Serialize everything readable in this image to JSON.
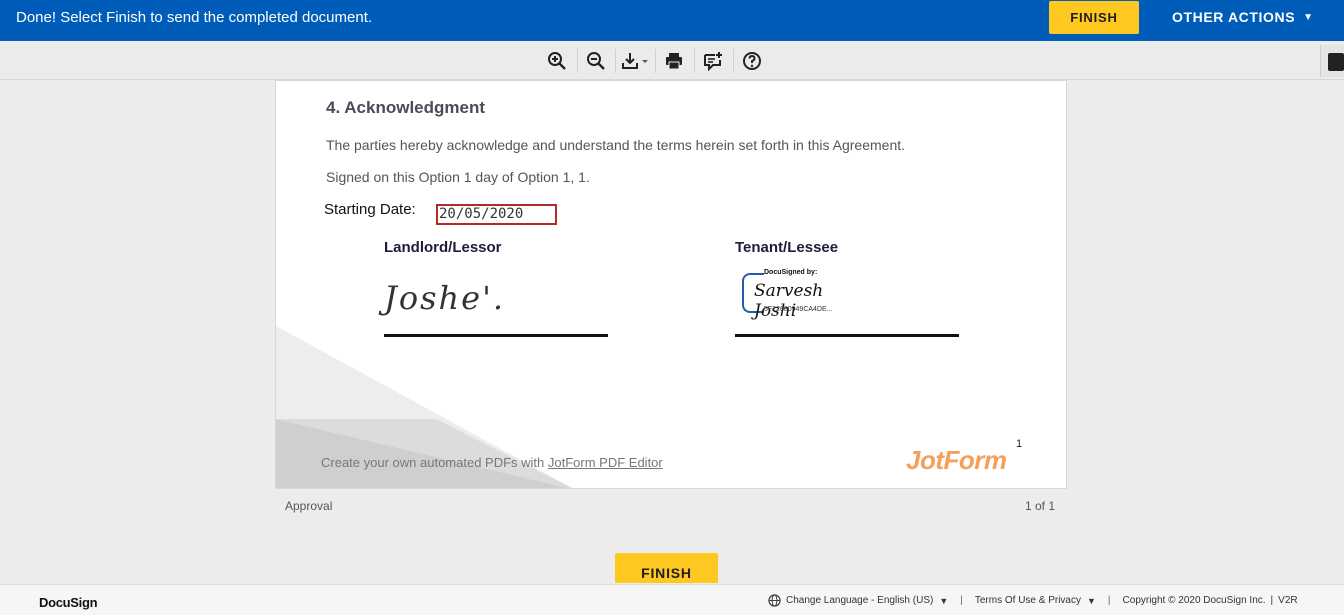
{
  "banner": {
    "message": "Done! Select Finish to send the completed document.",
    "finish_label": "FINISH",
    "other_actions_label": "OTHER ACTIONS",
    "other_actions_caret": "▼"
  },
  "toolbar": {
    "icons": [
      "zoom-in-icon",
      "zoom-out-icon",
      "download-icon",
      "print-icon",
      "add-comment-icon",
      "help-icon"
    ]
  },
  "document": {
    "section_title": "4. Acknowledgment",
    "ack_text": "The parties hereby acknowledge and understand the terms herein set forth in this Agreement.",
    "signed_text": "Signed on this Option 1 day of Option 1, 1.",
    "starting_date_label": "Starting Date:",
    "starting_date_value": "20/05/2020",
    "landlord_label": "Landlord/Lessor",
    "tenant_label": "Tenant/Lessee",
    "landlord_signature": "Joshe'.",
    "docusigned_by": "DocuSigned by:",
    "tenant_signature": "Sarvesh Joshi",
    "docusign_id": "5F22680949CA4DE...",
    "page_number": "1",
    "promo_text": "Create your own automated PDFs with ",
    "promo_link": "JotForm PDF Editor",
    "jotform_logo": "JotForm"
  },
  "below_page": {
    "doc_name": "Approval",
    "page_count": "1 of 1",
    "finish_label": "FINISH"
  },
  "footer": {
    "logo": "DocuSign",
    "change_language": "Change Language - English (US)",
    "terms": "Terms Of Use & Privacy",
    "copyright": "Copyright © 2020 DocuSign Inc.",
    "version": "V2R"
  },
  "colors": {
    "banner_bg": "#005cb9",
    "finish_bg": "#ffc820",
    "date_border": "#b22a2a",
    "jotform_orange": "#f5a05a"
  }
}
